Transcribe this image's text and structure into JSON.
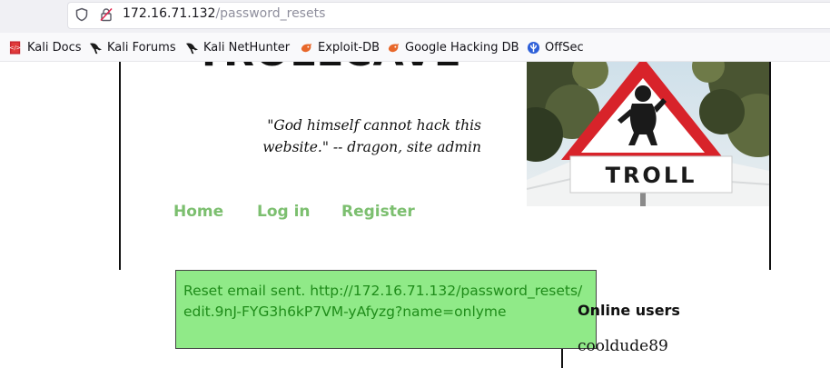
{
  "browser": {
    "url_host": "172.16.71.132",
    "url_path": "/password_resets",
    "bookmarks": [
      {
        "label": "Kali Docs",
        "icon": "kali-docs-icon"
      },
      {
        "label": "Kali Forums",
        "icon": "kali-dragon-icon"
      },
      {
        "label": "Kali NetHunter",
        "icon": "kali-dragon-icon"
      },
      {
        "label": "Exploit-DB",
        "icon": "exploit-db-icon"
      },
      {
        "label": "Google Hacking DB",
        "icon": "exploit-db-icon"
      },
      {
        "label": "OffSec",
        "icon": "offsec-icon"
      }
    ]
  },
  "site": {
    "title": "TROLLCAVE",
    "quote": "\"God himself cannot hack this website.\" -- dragon, site admin",
    "nav": [
      {
        "label": "Home"
      },
      {
        "label": "Log in"
      },
      {
        "label": "Register"
      }
    ],
    "header_image": {
      "sign_text": "TROLL"
    }
  },
  "flash": {
    "message": "Reset email sent. http://172.16.71.132/password_resets/edit.9nJ-FYG3h6kP7VM-yAfyzg?name=onlyme"
  },
  "sidebar": {
    "title": "Online users",
    "users": [
      "cooldude89"
    ]
  },
  "colors": {
    "nav_link": "#7cbf6f",
    "flash_bg": "#90ea88",
    "flash_text": "#1f8c1a",
    "exploit_orange": "#e8672a",
    "kali_red": "#d82c2c"
  }
}
